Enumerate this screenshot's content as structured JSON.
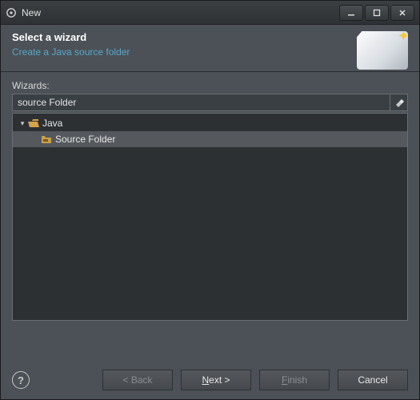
{
  "window": {
    "title": "New"
  },
  "banner": {
    "title": "Select a wizard",
    "subtitle": "Create a Java source folder"
  },
  "wizards": {
    "label": "Wizards:",
    "filter_value": "source Folder",
    "tree": {
      "group_label": "Java",
      "item_label": "Source Folder"
    }
  },
  "buttons": {
    "back": "< Back",
    "next": "Next >",
    "finish": "Finish",
    "cancel": "Cancel"
  }
}
